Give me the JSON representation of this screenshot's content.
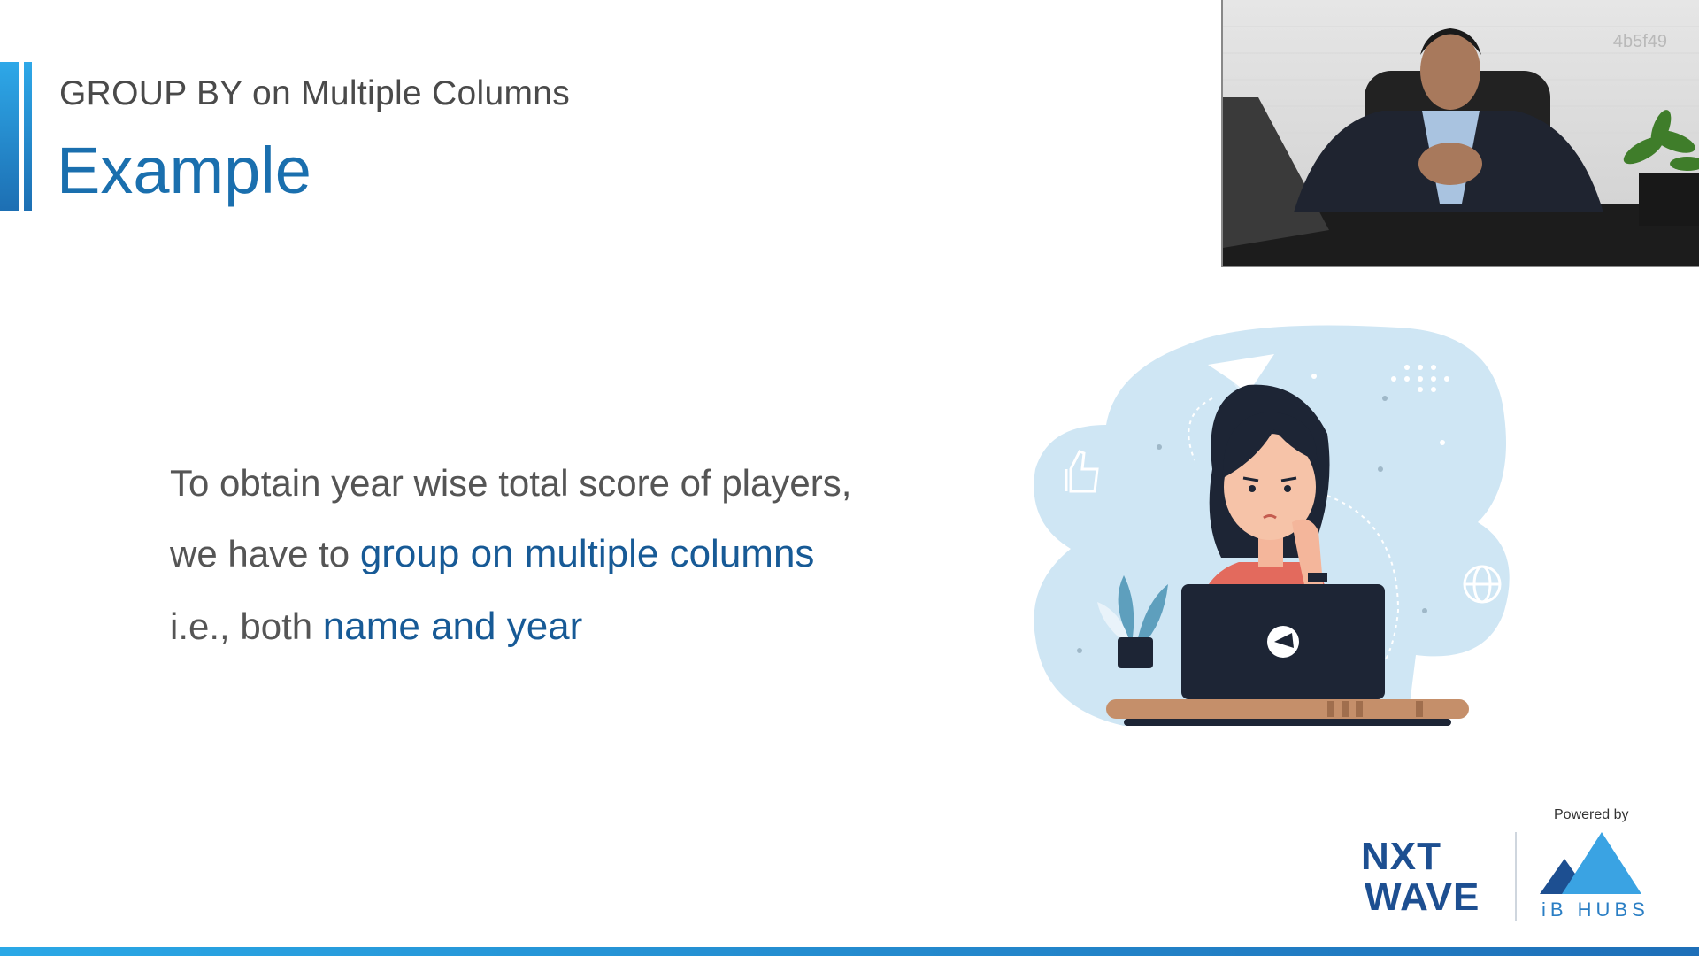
{
  "slide": {
    "subtitle": "GROUP BY on Multiple Columns",
    "title": "Example",
    "body": {
      "line1": "To obtain year wise total score of players,",
      "line2_prefix": "we have to ",
      "line2_highlight": "group on multiple columns",
      "line3_prefix": "i.e., both ",
      "line3_highlight": "name and year"
    },
    "colors": {
      "title": "#1a6fae",
      "highlight": "#175a96",
      "accent": "#2ea8e8",
      "text": "#555555"
    }
  },
  "video": {
    "overlay_code": "4b5f49"
  },
  "branding": {
    "powered_by": "Powered by",
    "nxt": "NXT",
    "wave": "WAVE",
    "ibhubs": "iB HUBS"
  }
}
